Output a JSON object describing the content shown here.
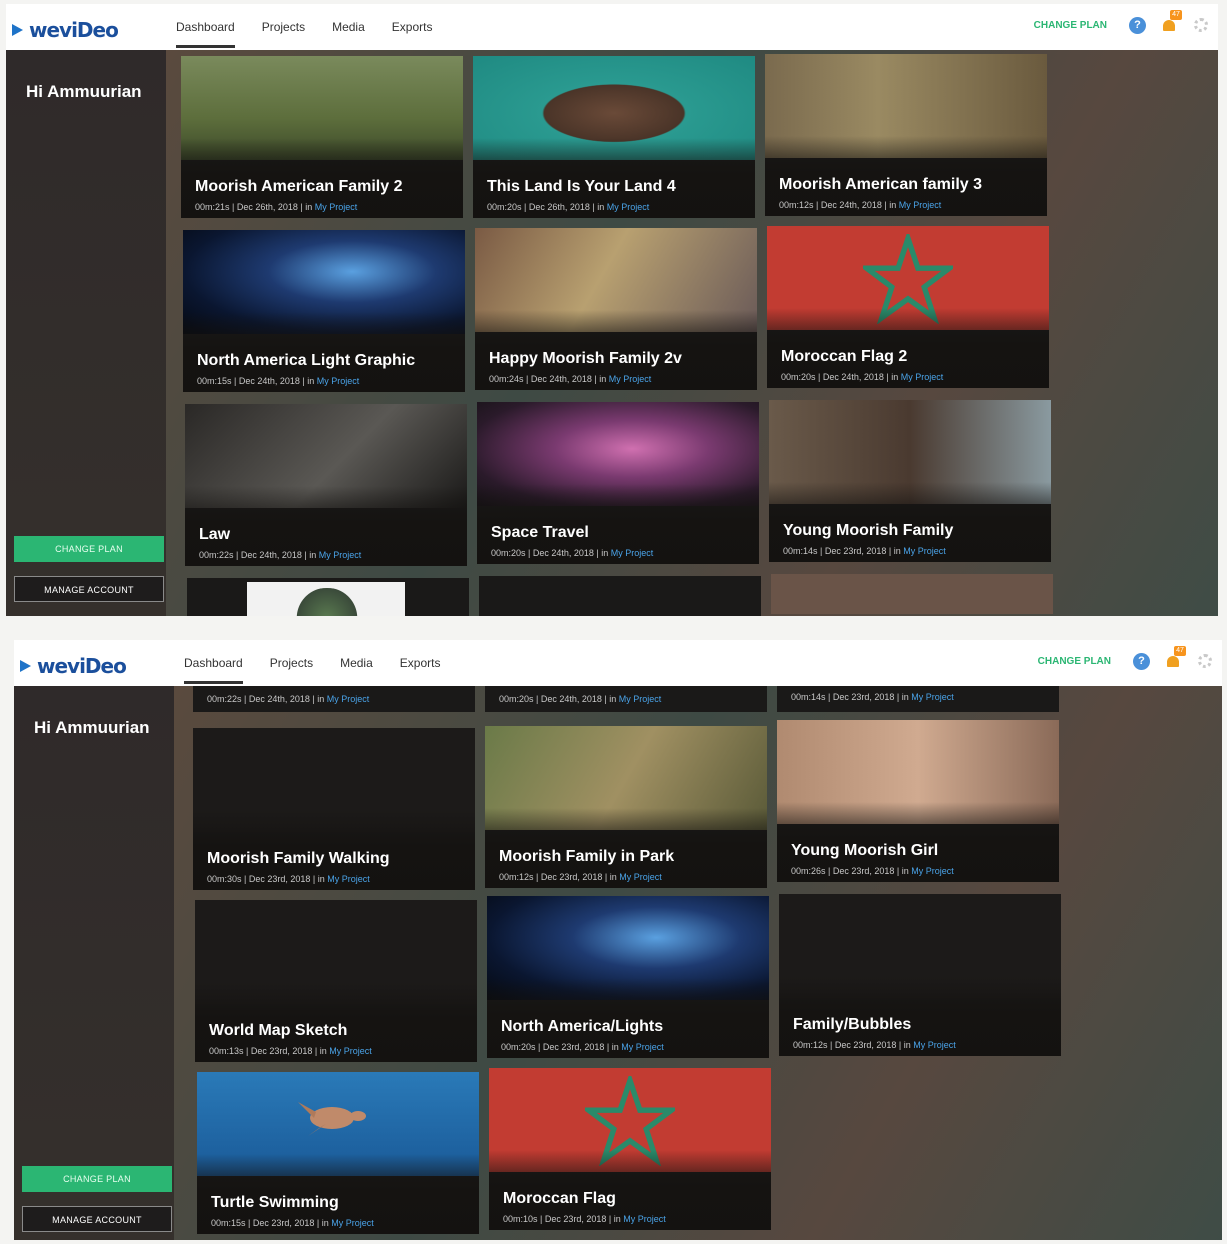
{
  "app": {
    "logo_text": "weviDeo",
    "nav": [
      "Dashboard",
      "Projects",
      "Media",
      "Exports"
    ],
    "change_plan_link": "CHANGE PLAN",
    "help_glyph": "?",
    "notification_count": "47",
    "greeting": "Hi Ammuurian",
    "sidebar_change_plan": "CHANGE PLAN",
    "sidebar_manage_account": "MANAGE ACCOUNT"
  },
  "colors": {
    "accent_green": "#2bb673",
    "link_blue": "#4aa3e8",
    "logo_blue": "#1b4f9c"
  },
  "meta_in": "in",
  "meta_link": "My Project",
  "projects_1": [
    {
      "title": "Moorish American Family 2",
      "meta": "00m:21s | Dec 26th, 2018 |"
    },
    {
      "title": "This Land Is Your Land 4",
      "meta": "00m:20s | Dec 26th, 2018 |"
    },
    {
      "title": "Moorish American family 3",
      "meta": "00m:12s | Dec 24th, 2018 |"
    },
    {
      "title": "North America Light Graphic",
      "meta": "00m:15s | Dec 24th, 2018 |"
    },
    {
      "title": "Happy Moorish Family 2v",
      "meta": "00m:24s | Dec 24th, 2018 |"
    },
    {
      "title": "Moroccan Flag 2",
      "meta": "00m:20s | Dec 24th, 2018 |"
    },
    {
      "title": "Law",
      "meta": "00m:22s | Dec 24th, 2018 |"
    },
    {
      "title": "Space Travel",
      "meta": "00m:20s | Dec 24th, 2018 |"
    },
    {
      "title": "Young Moorish Family",
      "meta": "00m:14s | Dec 23rd, 2018 |"
    }
  ],
  "projects_2_partial": [
    {
      "meta": "00m:22s | Dec 24th, 2018 |"
    },
    {
      "meta": "00m:20s | Dec 24th, 2018 |"
    },
    {
      "meta": "00m:14s | Dec 23rd, 2018 |"
    }
  ],
  "projects_2": [
    {
      "title": "Moorish Family Walking",
      "meta": "00m:30s | Dec 23rd, 2018 |"
    },
    {
      "title": "Moorish Family in Park",
      "meta": "00m:12s | Dec 23rd, 2018 |"
    },
    {
      "title": "Young Moorish Girl",
      "meta": "00m:26s | Dec 23rd, 2018 |"
    },
    {
      "title": "World Map Sketch",
      "meta": "00m:13s | Dec 23rd, 2018 |"
    },
    {
      "title": "North America/Lights",
      "meta": "00m:20s | Dec 23rd, 2018 |"
    },
    {
      "title": "Family/Bubbles",
      "meta": "00m:12s | Dec 23rd, 2018 |"
    },
    {
      "title": "Turtle Swimming",
      "meta": "00m:15s | Dec 23rd, 2018 |"
    },
    {
      "title": "Moroccan Flag",
      "meta": "00m:10s | Dec 23rd, 2018 |"
    }
  ]
}
